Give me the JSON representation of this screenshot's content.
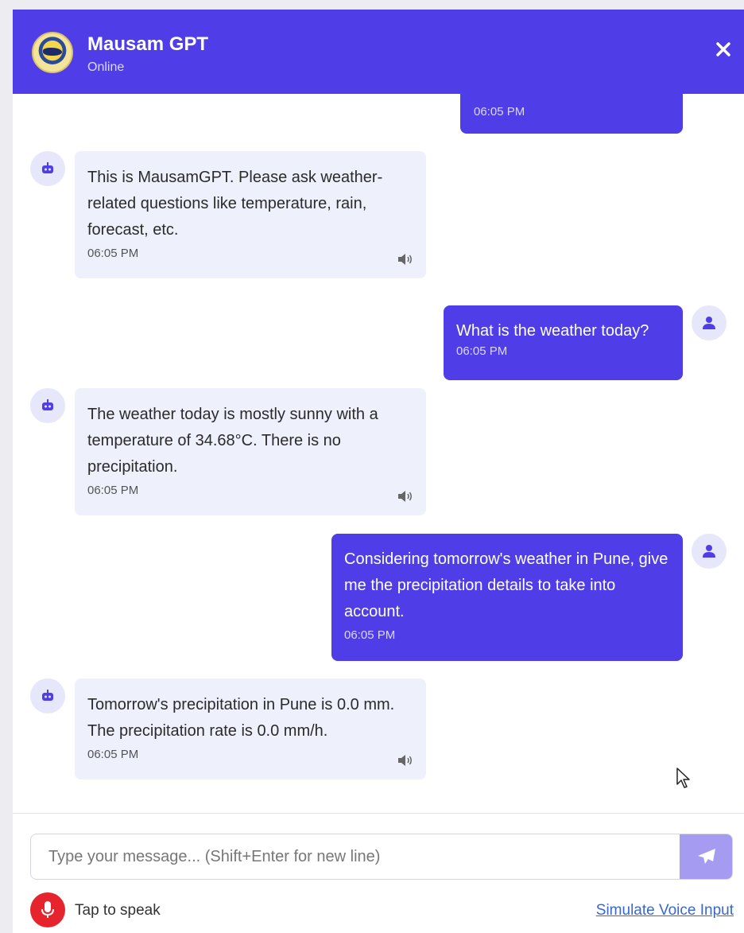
{
  "header": {
    "title": "Mausam GPT",
    "status": "Online",
    "close_icon": "close-icon",
    "brand_color": "#4f3ee8"
  },
  "messages": [
    {
      "sender": "user",
      "text": "",
      "time": "06:05 PM"
    },
    {
      "sender": "bot",
      "text": "This is MausamGPT. Please ask weather-related questions like temperature, rain, forecast, etc.",
      "time": "06:05 PM"
    },
    {
      "sender": "user",
      "text": "What is the weather today?",
      "time": "06:05 PM"
    },
    {
      "sender": "bot",
      "text": "The weather today is mostly sunny with a temperature of 34.68°C. There is no precipitation.",
      "time": "06:05 PM"
    },
    {
      "sender": "user",
      "text": "Considering tomorrow's weather in Pune, give me the precipitation details to take into account.",
      "time": "06:05 PM"
    },
    {
      "sender": "bot",
      "text": "Tomorrow's precipitation in Pune is 0.0 mm. The precipitation rate is 0.0 mm/h.",
      "time": "06:05 PM"
    }
  ],
  "composer": {
    "placeholder": "Type your message... (Shift+Enter for new line)",
    "value": "",
    "send_icon": "paper-plane-icon"
  },
  "voice": {
    "tap_label": "Tap to speak",
    "simulate_label": "Simulate Voice Input",
    "mic_color": "#e5242d"
  }
}
